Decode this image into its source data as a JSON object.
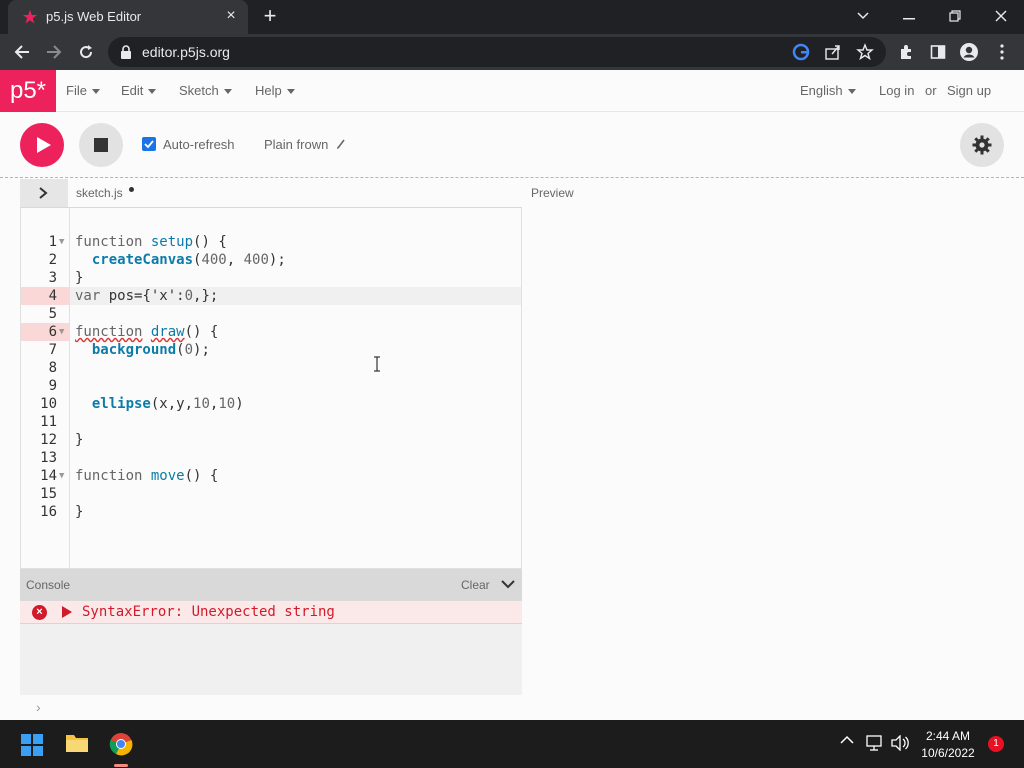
{
  "browser": {
    "tab_title": "p5.js Web Editor",
    "url": "editor.p5js.org",
    "new_tab_label": "+",
    "close_tab_label": "×"
  },
  "nav": {
    "logo": "p5*",
    "menus": [
      {
        "label": "File"
      },
      {
        "label": "Edit"
      },
      {
        "label": "Sketch"
      },
      {
        "label": "Help"
      }
    ],
    "language": "English",
    "login": "Log in",
    "or": "or",
    "signup": "Sign up"
  },
  "toolbar": {
    "auto_refresh_label": "Auto-refresh",
    "auto_refresh_checked": true,
    "sketch_name": "Plain frown"
  },
  "editor": {
    "filename": "sketch.js",
    "preview_label": "Preview",
    "active_line": 4,
    "lines": [
      {
        "n": "1",
        "text": "function setup() {"
      },
      {
        "n": "2",
        "text": "  createCanvas(400, 400);"
      },
      {
        "n": "3",
        "text": "}"
      },
      {
        "n": "4",
        "text": "var pos={'x':0,};"
      },
      {
        "n": "5",
        "text": ""
      },
      {
        "n": "6",
        "text": "function draw() {"
      },
      {
        "n": "7",
        "text": "  background(0);"
      },
      {
        "n": "8",
        "text": ""
      },
      {
        "n": "9",
        "text": ""
      },
      {
        "n": "10",
        "text": "  ellipse(x,y,10,10)"
      },
      {
        "n": "11",
        "text": ""
      },
      {
        "n": "12",
        "text": "}"
      },
      {
        "n": "13",
        "text": ""
      },
      {
        "n": "14",
        "text": "function move() {"
      },
      {
        "n": "15",
        "text": ""
      },
      {
        "n": "16",
        "text": "}"
      }
    ]
  },
  "console": {
    "title": "Console",
    "clear_label": "Clear",
    "error_message": "SyntaxError: Unexpected string",
    "prompt": "›"
  },
  "taskbar": {
    "time": "2:44 AM",
    "date": "10/6/2022",
    "notifications": "1"
  },
  "colors": {
    "accent": "#ed225d",
    "error": "#d11a2a"
  }
}
